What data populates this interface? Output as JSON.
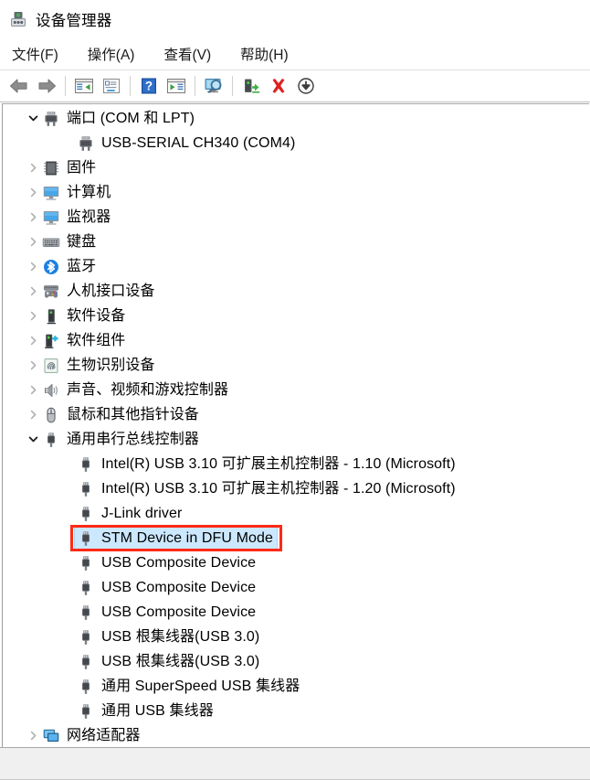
{
  "window": {
    "title": "设备管理器",
    "icon": "device-manager-icon"
  },
  "menubar": {
    "items": [
      {
        "label": "文件(F)",
        "name": "menu-file"
      },
      {
        "label": "操作(A)",
        "name": "menu-action"
      },
      {
        "label": "查看(V)",
        "name": "menu-view"
      },
      {
        "label": "帮助(H)",
        "name": "menu-help"
      }
    ]
  },
  "toolbar": {
    "buttons": [
      {
        "icon": "back-arrow-icon",
        "name": "toolbar-back"
      },
      {
        "icon": "forward-arrow-icon",
        "name": "toolbar-forward"
      },
      {
        "separator": true
      },
      {
        "icon": "show-hide-console-tree-icon",
        "name": "toolbar-show-hide-tree"
      },
      {
        "icon": "properties-icon",
        "name": "toolbar-properties"
      },
      {
        "separator": true
      },
      {
        "icon": "help-question-icon",
        "name": "toolbar-help"
      },
      {
        "icon": "action-pane-icon",
        "name": "toolbar-action-pane"
      },
      {
        "separator": true
      },
      {
        "icon": "scan-hardware-changes-icon",
        "name": "toolbar-scan-hardware"
      },
      {
        "separator": true
      },
      {
        "icon": "update-driver-icon",
        "name": "toolbar-update-driver"
      },
      {
        "icon": "uninstall-device-icon",
        "name": "toolbar-uninstall-device"
      },
      {
        "icon": "disable-device-icon",
        "name": "toolbar-disable-device"
      }
    ]
  },
  "tree": {
    "rows": [
      {
        "level": 0,
        "expander": "expanded",
        "icon": "port-icon",
        "label": "端口 (COM 和 LPT)",
        "selected": false
      },
      {
        "level": 1,
        "expander": "none",
        "icon": "port-icon",
        "label": "USB-SERIAL CH340 (COM4)",
        "selected": false
      },
      {
        "level": 0,
        "expander": "collapsed",
        "icon": "firmware-icon",
        "label": "固件",
        "selected": false
      },
      {
        "level": 0,
        "expander": "collapsed",
        "icon": "computer-icon",
        "label": "计算机",
        "selected": false
      },
      {
        "level": 0,
        "expander": "collapsed",
        "icon": "monitor-icon",
        "label": "监视器",
        "selected": false
      },
      {
        "level": 0,
        "expander": "collapsed",
        "icon": "keyboard-icon",
        "label": "键盘",
        "selected": false
      },
      {
        "level": 0,
        "expander": "collapsed",
        "icon": "bluetooth-icon",
        "label": "蓝牙",
        "selected": false
      },
      {
        "level": 0,
        "expander": "collapsed",
        "icon": "hid-icon",
        "label": "人机接口设备",
        "selected": false
      },
      {
        "level": 0,
        "expander": "collapsed",
        "icon": "software-device-icon",
        "label": "软件设备",
        "selected": false
      },
      {
        "level": 0,
        "expander": "collapsed",
        "icon": "software-component-icon",
        "label": "软件组件",
        "selected": false
      },
      {
        "level": 0,
        "expander": "collapsed",
        "icon": "biometric-icon",
        "label": "生物识别设备",
        "selected": false
      },
      {
        "level": 0,
        "expander": "collapsed",
        "icon": "sound-icon",
        "label": "声音、视频和游戏控制器",
        "selected": false
      },
      {
        "level": 0,
        "expander": "collapsed",
        "icon": "mouse-icon",
        "label": "鼠标和其他指针设备",
        "selected": false
      },
      {
        "level": 0,
        "expander": "expanded",
        "icon": "usb-icon",
        "label": "通用串行总线控制器",
        "selected": false
      },
      {
        "level": 1,
        "expander": "none",
        "icon": "usb-icon",
        "label": "Intel(R) USB 3.10 可扩展主机控制器 - 1.10 (Microsoft)",
        "selected": false
      },
      {
        "level": 1,
        "expander": "none",
        "icon": "usb-icon",
        "label": "Intel(R) USB 3.10 可扩展主机控制器 - 1.20 (Microsoft)",
        "selected": false
      },
      {
        "level": 1,
        "expander": "none",
        "icon": "usb-icon",
        "label": "J-Link driver",
        "selected": false
      },
      {
        "level": 1,
        "expander": "none",
        "icon": "usb-icon",
        "label": "STM Device in DFU Mode",
        "selected": true
      },
      {
        "level": 1,
        "expander": "none",
        "icon": "usb-icon",
        "label": "USB Composite Device",
        "selected": false
      },
      {
        "level": 1,
        "expander": "none",
        "icon": "usb-icon",
        "label": "USB Composite Device",
        "selected": false
      },
      {
        "level": 1,
        "expander": "none",
        "icon": "usb-icon",
        "label": "USB Composite Device",
        "selected": false
      },
      {
        "level": 1,
        "expander": "none",
        "icon": "usb-icon",
        "label": "USB 根集线器(USB 3.0)",
        "selected": false
      },
      {
        "level": 1,
        "expander": "none",
        "icon": "usb-icon",
        "label": "USB 根集线器(USB 3.0)",
        "selected": false
      },
      {
        "level": 1,
        "expander": "none",
        "icon": "usb-icon",
        "label": "通用 SuperSpeed USB 集线器",
        "selected": false
      },
      {
        "level": 1,
        "expander": "none",
        "icon": "usb-icon",
        "label": "通用 USB 集线器",
        "selected": false
      },
      {
        "level": 0,
        "expander": "collapsed",
        "icon": "network-adapter-icon",
        "label": "网络适配器",
        "selected": false
      }
    ]
  },
  "annotation": {
    "name": "highlight-rectangle-stm-device",
    "color": "#fc2a17",
    "target_label": "STM Device in DFU Mode"
  },
  "colors": {
    "selection_fill": "#cce8ff",
    "selection_border": "#a6d4f5",
    "annotation_red": "#fc2a17",
    "toolbar_divider": "#bdbdbd",
    "statusbar_bg": "#f0f0f0"
  }
}
